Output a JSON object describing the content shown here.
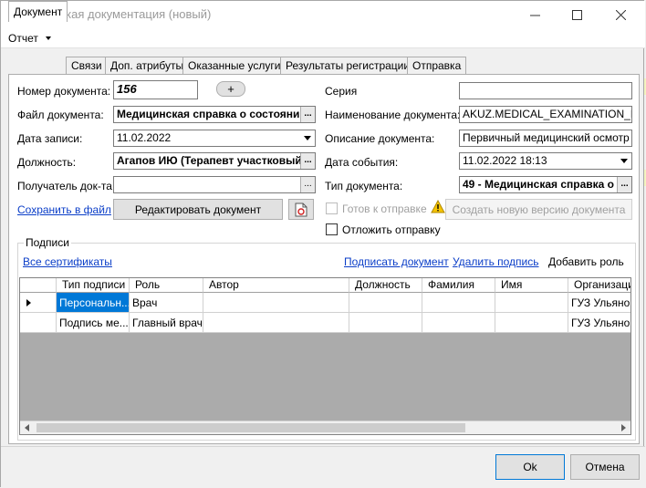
{
  "window": {
    "title": "Медицинская документация (новый)"
  },
  "menu": {
    "report": "Отчет"
  },
  "tabs": [
    {
      "label": "Документ"
    },
    {
      "label": "Связи"
    },
    {
      "label": "Доп. атрибуты"
    },
    {
      "label": "Оказанные услуги"
    },
    {
      "label": "Результаты регистрации"
    },
    {
      "label": "Отправка"
    }
  ],
  "left": {
    "doc_number_label": "Номер документа:",
    "doc_number": "156",
    "add_btn": "+",
    "file_label": "Файл документа:",
    "file_value": "Медицинская справка о состояни",
    "record_date_label": "Дата записи:",
    "record_date": "11.02.2022",
    "position_label": "Должность:",
    "position_value": "Агапов ИЮ (Терапевт участковый)",
    "recipient_label": "Получатель док-та",
    "recipient_value": "",
    "save_to_file": "Сохранить в файл",
    "edit_doc": "Редактировать документ"
  },
  "right": {
    "series_label": "Серия",
    "series_value": "",
    "doc_name_label": "Наименование документа:",
    "doc_name_value": "AKUZ.MEDICAL_EXAMINATION_MAI",
    "doc_desc_label": "Описание документа:",
    "doc_desc_value": "Первичный медицинский осмотр",
    "event_date_label": "Дата события:",
    "event_date_value": "11.02.2022 18:13",
    "doc_type_label": "Тип документа:",
    "doc_type_value": "49 - Медицинская справка о",
    "ready_label": "Готов к отправке",
    "new_version": "Создать новую версию документа",
    "postpone_label": "Отложить отправку"
  },
  "signatures": {
    "group_title": "Подписи",
    "all_certs": "Все сертификаты",
    "sign_doc": "Подписать документ",
    "delete_sig": "Удалить подпись",
    "add_role": "Добавить роль",
    "columns": [
      "Тип подписи",
      "Роль",
      "Автор",
      "Должность",
      "Фамилия",
      "Имя",
      "Организаци"
    ],
    "rows": [
      [
        "Персональн...",
        "Врач",
        "",
        "",
        "",
        "",
        "ГУЗ Ульянов"
      ],
      [
        "Подпись ме...",
        "Главный врач",
        "",
        "",
        "",
        "",
        "ГУЗ Ульянов"
      ]
    ]
  },
  "footer": {
    "ok": "Ok",
    "cancel": "Отмена"
  },
  "colors": {
    "accent": "#0078d7",
    "link": "#0b3ec8"
  }
}
